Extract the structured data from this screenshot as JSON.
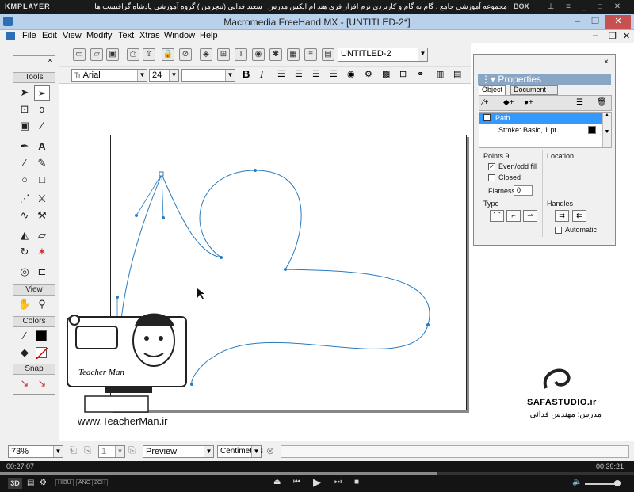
{
  "player": {
    "name": "KMPLAYER",
    "title": "مجموعه آموزشی جامع ، گام به گام و کاربردی نرم افزار فری هند ام ایکس  مدرس : سعید فدایی (تیچرمن ) گروه آموزشی پادشاه گرافیست ها",
    "box_label": "BOX",
    "time_current": "00:27:07",
    "time_total": "00:39:21",
    "badges": [
      "HIBU",
      "ANO",
      "2CH"
    ],
    "mode_3d": "3D"
  },
  "app": {
    "title": "Macromedia FreeHand MX - [UNTITLED-2*]",
    "menu": [
      "File",
      "Edit",
      "View",
      "Modify",
      "Text",
      "Xtras",
      "Window",
      "Help"
    ]
  },
  "toolbar": {
    "doc_select": "UNTITLED-2",
    "font_name": "Arial",
    "font_size": "24",
    "style_field": ""
  },
  "tools": {
    "header": "Tools",
    "view_header": "View",
    "colors_header": "Colors",
    "snap_header": "Snap"
  },
  "properties": {
    "title": "Properties",
    "tab_object": "Object",
    "tab_document": "Document",
    "list_path": "Path",
    "list_stroke": "Stroke: Basic, 1 pt",
    "points_label": "Points",
    "points_value": "9",
    "location_label": "Location",
    "evenodd_label": "Even/odd fill",
    "closed_label": "Closed",
    "flatness_label": "Flatness:",
    "flatness_value": "0",
    "type_label": "Type",
    "handles_label": "Handles",
    "automatic_label": "Automatic"
  },
  "status": {
    "zoom": "73%",
    "page": "1",
    "view_mode": "Preview",
    "units": "Centimeters"
  },
  "overlays": {
    "teacher_url": "www.TeacherMan.ir",
    "teacher_name": "Teacher Man",
    "studio": "SAFASTUDIO.ir",
    "instructor": "مدرس: مهندس فدائی"
  }
}
